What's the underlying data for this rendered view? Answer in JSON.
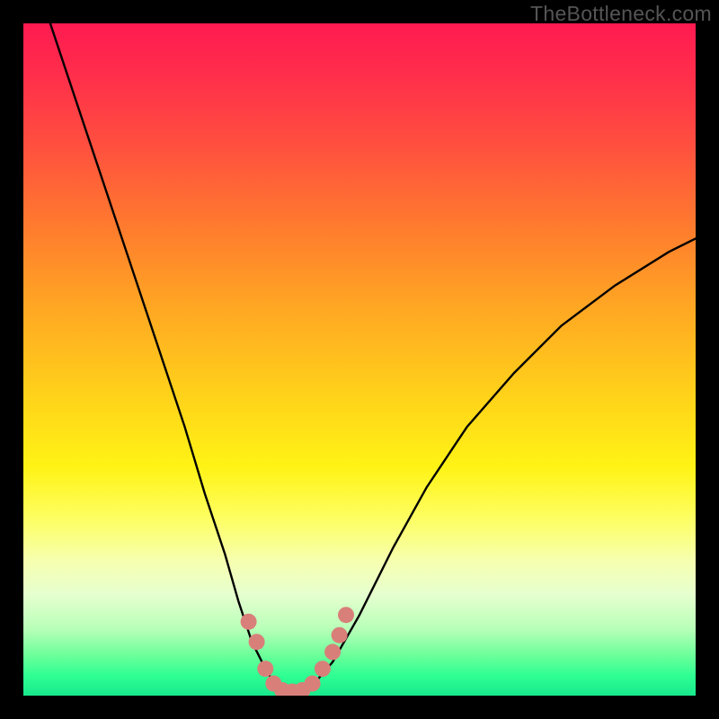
{
  "watermark": "TheBottleneck.com",
  "chart_data": {
    "type": "line",
    "title": "",
    "xlabel": "",
    "ylabel": "",
    "xlim": [
      0,
      100
    ],
    "ylim": [
      0,
      100
    ],
    "series": [
      {
        "name": "bottleneck-curve",
        "x": [
          4,
          8,
          12,
          16,
          20,
          24,
          27,
          30,
          32,
          34,
          36,
          37.5,
          39,
          41,
          43,
          46,
          50,
          55,
          60,
          66,
          73,
          80,
          88,
          96,
          100
        ],
        "values": [
          100,
          88,
          76,
          64,
          52,
          40,
          30,
          21,
          14,
          8,
          4,
          1.5,
          0.5,
          0.5,
          1.5,
          5,
          12,
          22,
          31,
          40,
          48,
          55,
          61,
          66,
          68
        ]
      }
    ],
    "markers": {
      "name": "highlight-dots",
      "color": "#d97f7a",
      "points": [
        {
          "x": 33.5,
          "y": 11
        },
        {
          "x": 34.7,
          "y": 8
        },
        {
          "x": 36.0,
          "y": 4
        },
        {
          "x": 37.2,
          "y": 1.8
        },
        {
          "x": 38.5,
          "y": 0.8
        },
        {
          "x": 40.0,
          "y": 0.6
        },
        {
          "x": 41.5,
          "y": 0.8
        },
        {
          "x": 43.0,
          "y": 1.8
        },
        {
          "x": 44.5,
          "y": 4
        },
        {
          "x": 46.0,
          "y": 6.5
        },
        {
          "x": 47.0,
          "y": 9
        },
        {
          "x": 48.0,
          "y": 12
        }
      ]
    }
  }
}
